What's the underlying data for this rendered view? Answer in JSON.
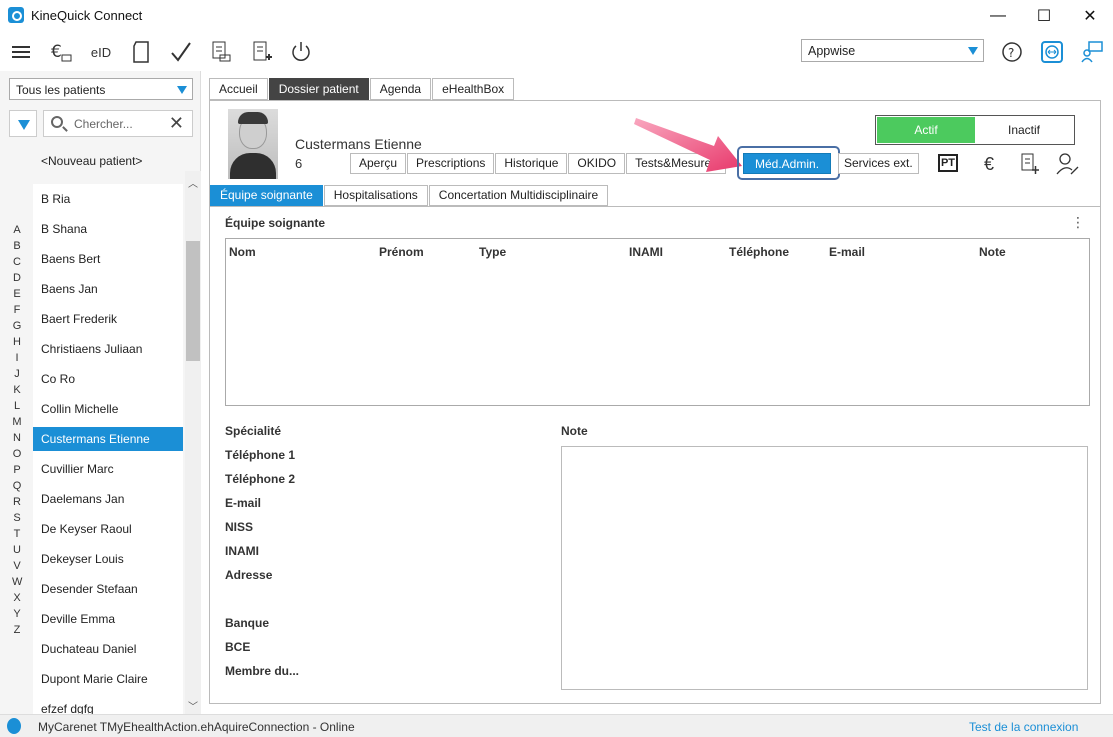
{
  "window": {
    "title": "KineQuick Connect",
    "minimize": "—",
    "maximize": "☐",
    "close": "✕"
  },
  "toolbar": {
    "icons": [
      "menu-icon",
      "euro-bank-icon",
      "eid-icon",
      "document-icon",
      "check-icon",
      "invoice-icon",
      "receipt-icon",
      "power-icon"
    ],
    "eid_label": "eID",
    "org_select": "Appwise",
    "right_icons": [
      "help-icon",
      "remote-icon",
      "chat-support-icon"
    ]
  },
  "sidebar": {
    "filter": "Tous les patients",
    "search_placeholder": "Chercher...",
    "new_patient": "<Nouveau patient>",
    "alphabet": [
      "A",
      "B",
      "C",
      "D",
      "E",
      "F",
      "G",
      "H",
      "I",
      "J",
      "K",
      "L",
      "M",
      "N",
      "O",
      "P",
      "Q",
      "R",
      "S",
      "T",
      "U",
      "V",
      "W",
      "X",
      "Y",
      "Z"
    ],
    "patients": [
      "B Ria",
      "B Shana",
      "Baens Bert",
      "Baens Jan",
      "Baert Frederik",
      "Christiaens Juliaan",
      "Co Ro",
      "Collin Michelle",
      "Custermans Etienne",
      "Cuvillier Marc",
      "Daelemans Jan",
      "De Keyser Raoul",
      "Dekeyser Louis",
      "Desender Stefaan",
      "Deville Emma",
      "Duchateau Daniel",
      "Dupont Marie Claire",
      "efzef dgfg"
    ],
    "selected_patient": "Custermans Etienne"
  },
  "main": {
    "tabs": [
      "Accueil",
      "Dossier patient",
      "Agenda",
      "eHealthBox"
    ],
    "active_tab": "Dossier patient",
    "patient": {
      "name": "Custermans Etienne",
      "id": "6"
    },
    "status": {
      "active": "Actif",
      "inactive": "Inactif",
      "active_color": "#4cca5e"
    },
    "subtabs": [
      "Aperçu",
      "Prescriptions",
      "Historique",
      "OKIDO",
      "Tests&Mesures"
    ],
    "subtab_selected": "Méd.Admin.",
    "subtab_after": "Services ext.",
    "header_icons": {
      "pt": "PT",
      "euro": "€"
    },
    "inner_tabs": [
      "Équipe soignante",
      "Hospitalisations",
      "Concertation Multidisciplinaire"
    ],
    "active_inner_tab": "Équipe soignante",
    "section_title": "Équipe soignante",
    "table_columns": [
      "Nom",
      "Prénom",
      "Type",
      "INAMI",
      "Téléphone",
      "E-mail",
      "Note"
    ],
    "fields": [
      "Spécialité",
      "Téléphone 1",
      "Téléphone 2",
      "E-mail",
      "NISS",
      "INAMI",
      "Adresse",
      "Banque",
      "BCE",
      "Membre du..."
    ],
    "note_label": "Note"
  },
  "statusbar": {
    "text": "MyCarenet TMyEhealthAction.ehAquireConnection - Online",
    "test_link": "Test de la connexion"
  },
  "colors": {
    "accent": "#1b8fd6",
    "annotation_arrow": "#e8386b"
  }
}
